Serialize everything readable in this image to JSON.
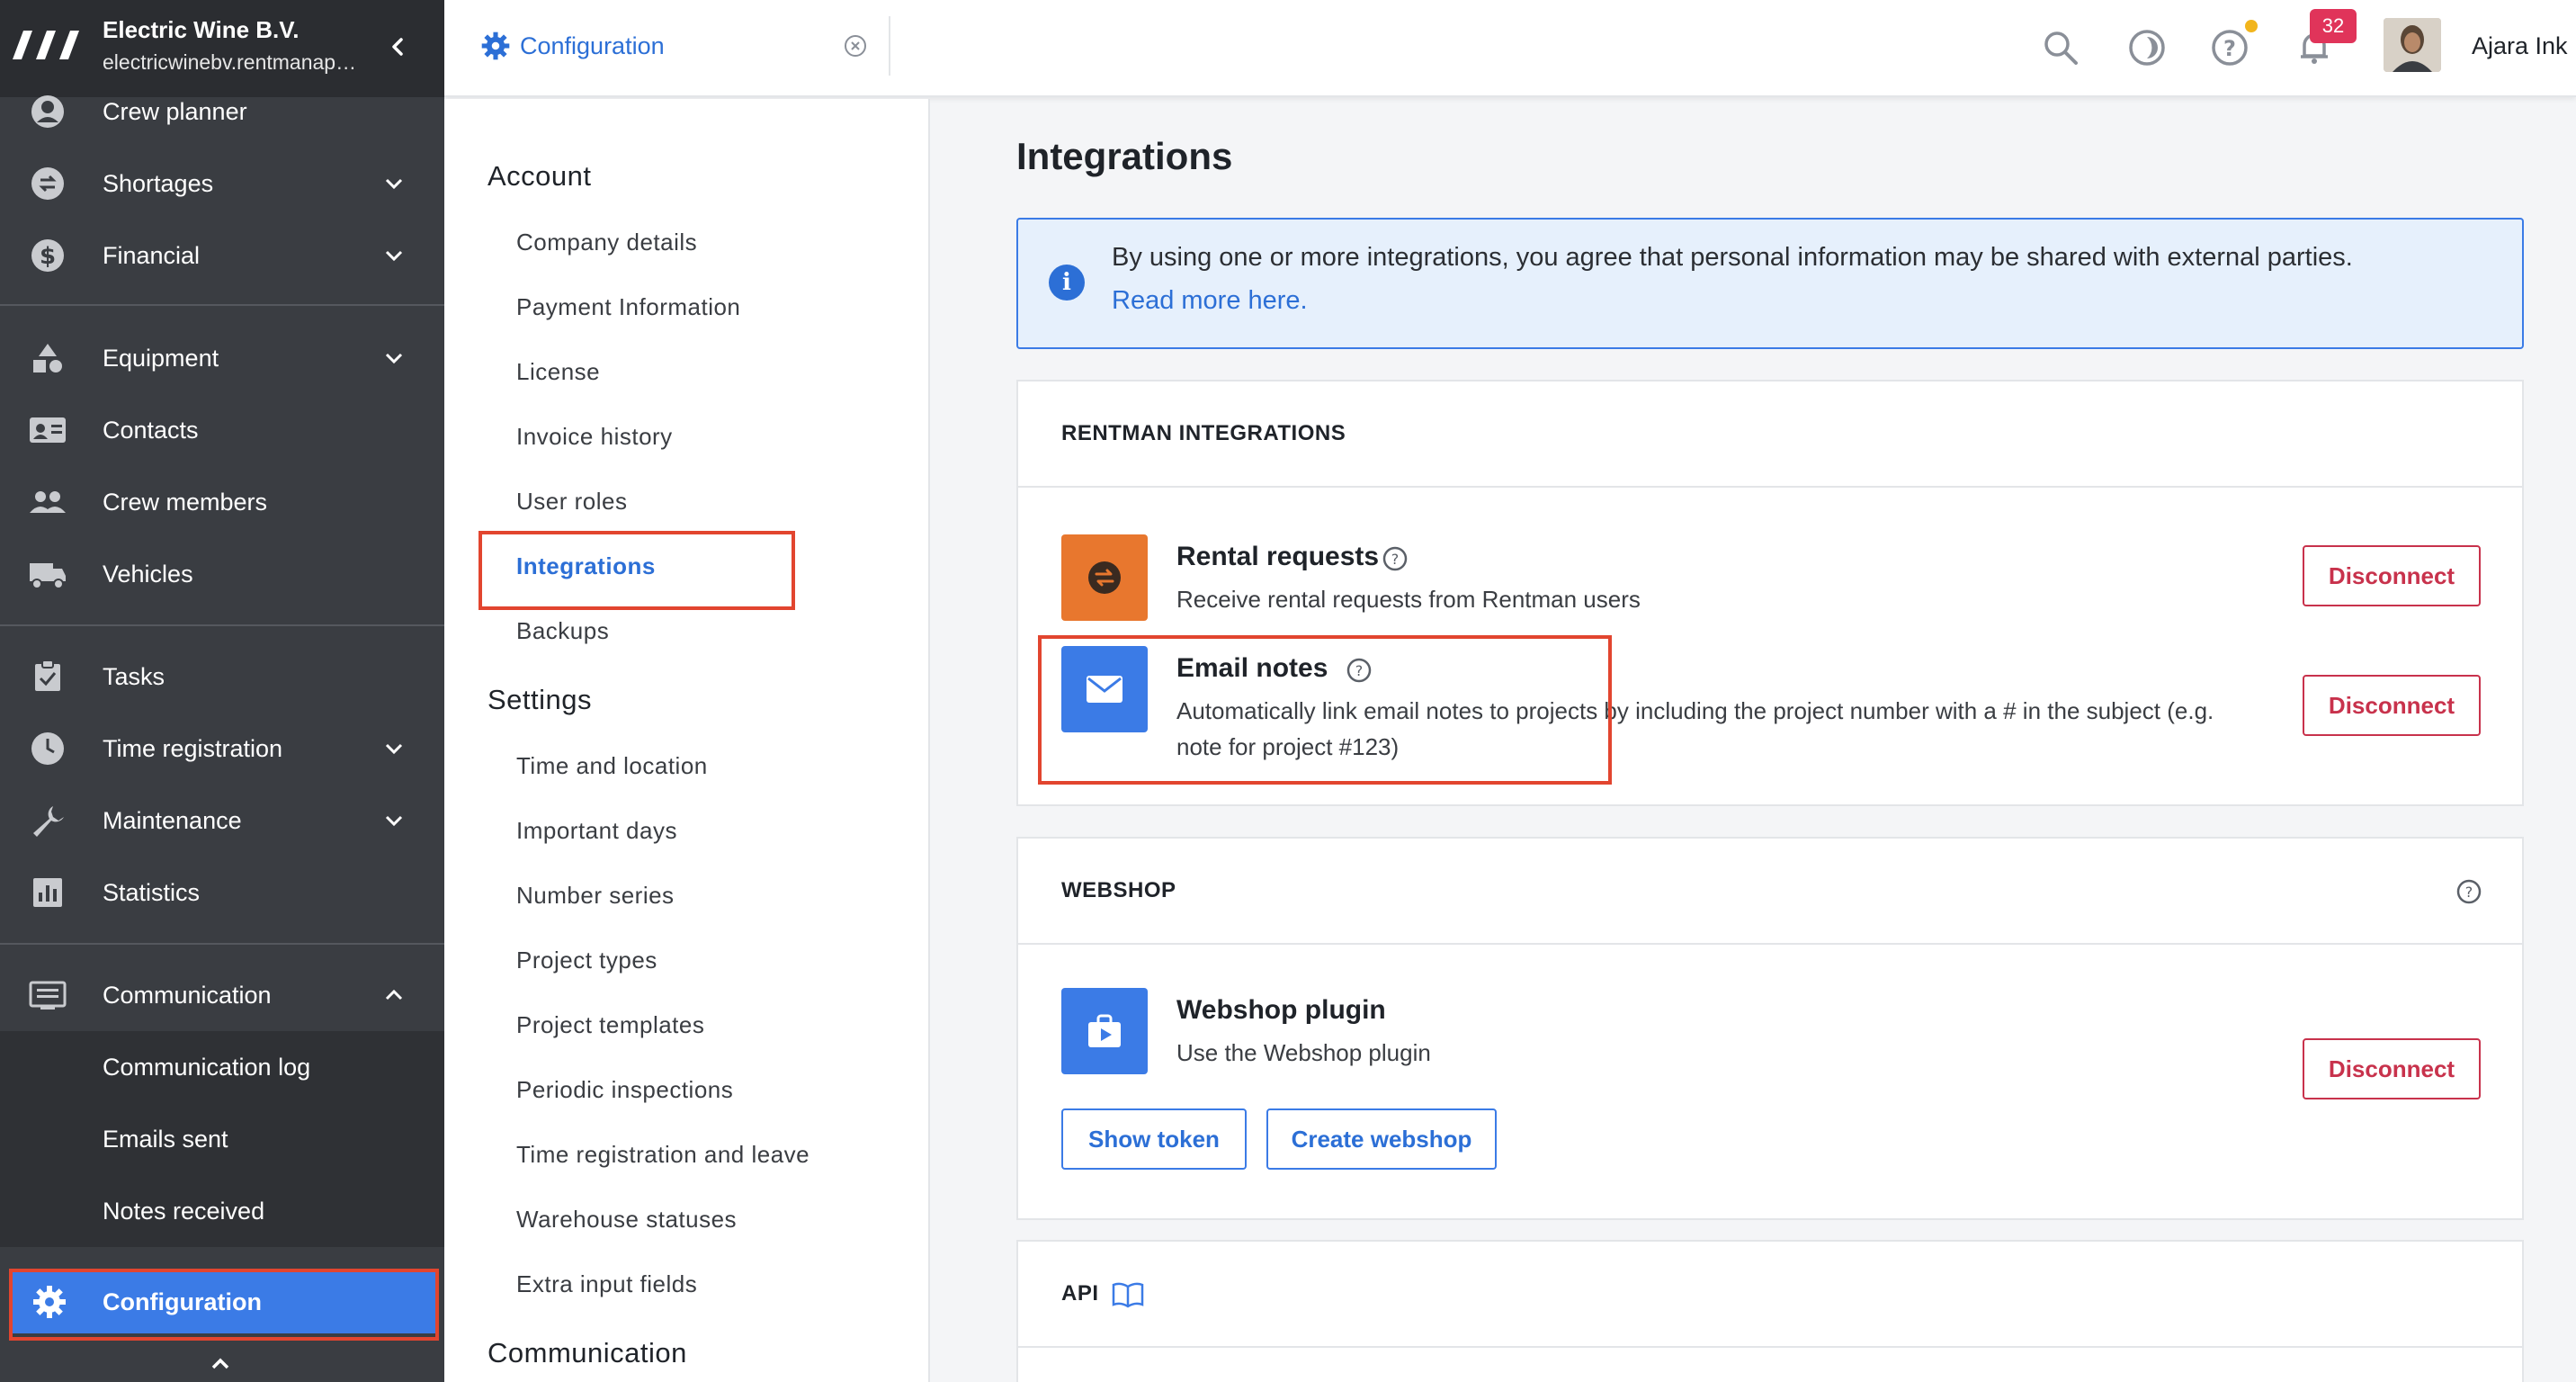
{
  "sidebar": {
    "company_name": "Electric Wine B.V.",
    "company_domain": "electricwinebv.rentmanap…",
    "items": [
      {
        "label": "Crew planner",
        "icon": "crew-planner-icon"
      },
      {
        "label": "Shortages",
        "icon": "shortages-icon"
      },
      {
        "label": "Financial",
        "icon": "financial-icon"
      },
      {
        "label": "Equipment",
        "icon": "equipment-icon"
      },
      {
        "label": "Contacts",
        "icon": "contacts-icon"
      },
      {
        "label": "Crew members",
        "icon": "crew-members-icon"
      },
      {
        "label": "Vehicles",
        "icon": "vehicles-icon"
      },
      {
        "label": "Tasks",
        "icon": "tasks-icon"
      },
      {
        "label": "Time registration",
        "icon": "clock-icon"
      },
      {
        "label": "Maintenance",
        "icon": "wrench-icon"
      },
      {
        "label": "Statistics",
        "icon": "statistics-icon"
      },
      {
        "label": "Communication",
        "icon": "communication-icon"
      }
    ],
    "sub_items": [
      {
        "label": "Communication log"
      },
      {
        "label": "Emails sent"
      },
      {
        "label": "Notes received"
      }
    ],
    "active_item": {
      "label": "Configuration",
      "icon": "gear-icon"
    }
  },
  "topbar": {
    "tab_label": "Configuration",
    "notification_count": "32",
    "user_name": "Ajara Ink"
  },
  "subnav": {
    "account_heading": "Account",
    "account_items": [
      "Company details",
      "Payment Information",
      "License",
      "Invoice history",
      "User roles",
      "Integrations",
      "Backups"
    ],
    "settings_heading": "Settings",
    "settings_items": [
      "Time and location",
      "Important days",
      "Number series",
      "Project types",
      "Project templates",
      "Periodic inspections",
      "Time registration and leave",
      "Warehouse statuses",
      "Extra input fields"
    ],
    "communication_heading": "Communication",
    "active": "Integrations"
  },
  "main": {
    "title": "Integrations",
    "banner_text": "By using one or more integrations, you agree that personal information may be shared with external parties.",
    "banner_link": "Read more here.",
    "rentman_card": {
      "heading": "RENTMAN INTEGRATIONS",
      "rental_name": "Rental requests",
      "rental_desc": "Receive rental requests from Rentman users",
      "rental_button": "Disconnect",
      "email_name": "Email notes",
      "email_desc_line1": "Automatically link email notes to projects by including the project number with a # in the subject (e.g.",
      "email_desc_line2": "note for project #123)",
      "email_button": "Disconnect"
    },
    "webshop_card": {
      "heading": "WEBSHOP",
      "name": "Webshop plugin",
      "desc": "Use the Webshop plugin",
      "disconnect_button": "Disconnect",
      "show_token_button": "Show token",
      "create_webshop_button": "Create webshop"
    },
    "api_card": {
      "heading": "API"
    }
  },
  "colors": {
    "sidebar_bg": "#3a3d42",
    "sidebar_header_bg": "#2b2d31",
    "accent_blue": "#3b7be6",
    "link_blue": "#2c6fd6",
    "disconnect_red": "#c8324c",
    "highlight_red": "#e2452f",
    "rental_orange": "#e8772e",
    "badge_pink": "#e0345a"
  }
}
